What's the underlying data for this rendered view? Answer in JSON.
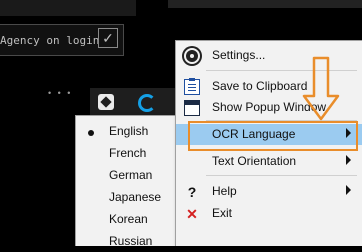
{
  "background": {
    "agency_text": "Agency on login",
    "checkbox_glyph": "✓"
  },
  "main_menu": {
    "items": [
      {
        "label": "Settings...",
        "icon": "gear-icon"
      },
      {
        "label": "Save to Clipboard",
        "icon": "clipboard-icon"
      },
      {
        "label": "Show Popup Window",
        "icon": "window-icon"
      },
      {
        "label": "OCR Language",
        "icon": "",
        "submenu": true,
        "highlighted": true
      },
      {
        "label": "Text Orientation",
        "icon": "",
        "submenu": true
      },
      {
        "label": "Help",
        "icon": "help-icon",
        "submenu": true
      },
      {
        "label": "Exit",
        "icon": "exit-icon"
      }
    ]
  },
  "language_menu": {
    "items": [
      "English",
      "French",
      "German",
      "Japanese",
      "Korean",
      "Russian"
    ],
    "selected": "English"
  },
  "glyphs": {
    "help": "?",
    "exit": "✕"
  },
  "colors": {
    "highlight": "#9bcbf0",
    "annotation": "#e98d2b"
  }
}
